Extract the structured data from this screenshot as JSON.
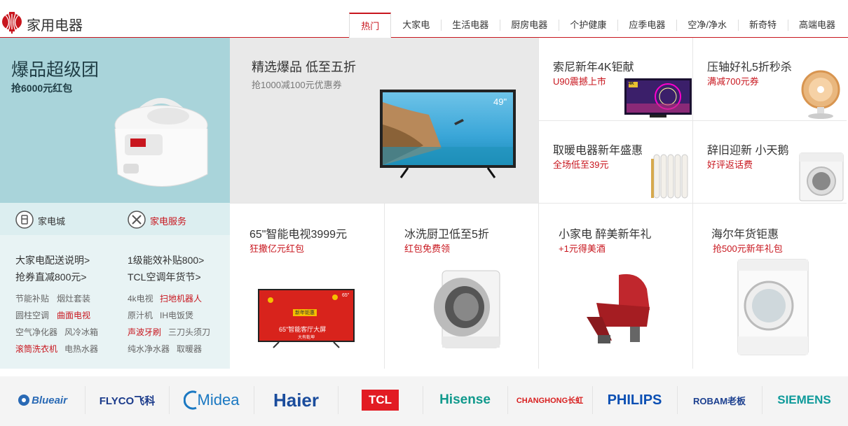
{
  "header": {
    "title": "家用电器",
    "tabs": [
      "热门",
      "大家电",
      "生活电器",
      "厨房电器",
      "个护健康",
      "应季电器",
      "空净/净水",
      "新奇特",
      "高端电器"
    ],
    "active_tab": "热门"
  },
  "hero": {
    "title": "爆品超级团",
    "subtitle": "抢6000元红包"
  },
  "banner": {
    "title": "精选爆品 低至五折",
    "subtitle": "抢1000减100元优惠券",
    "tv_size": "49\"",
    "dots": 4,
    "active_dot": 0
  },
  "promos_top": [
    {
      "title": "索尼新年4K钜献",
      "subtitle": "U90震撼上市",
      "badge": "4K"
    },
    {
      "title": "压轴好礼5折秒杀",
      "subtitle": "满减700元券"
    },
    {
      "title": "取暖电器新年盛惠",
      "subtitle": "全场低至39元"
    },
    {
      "title": "辞旧迎新 小天鹅",
      "subtitle": "好评返话费"
    }
  ],
  "services": {
    "mall": "家电城",
    "service": "家电服务"
  },
  "links": {
    "col1": [
      "大家电配送说明>",
      "抢券直减800元>"
    ],
    "col2": [
      "1级能效补贴800>",
      "TCL空调年货节>"
    ]
  },
  "tags": {
    "col1": [
      [
        "节能补贴",
        "烟灶套装"
      ],
      [
        "圆柱空调",
        "曲面电视"
      ],
      [
        "空气净化器",
        "风冷冰箱"
      ],
      [
        "滚筒洗衣机",
        "电热水器"
      ]
    ],
    "col2": [
      [
        "4k电视",
        "扫地机器人"
      ],
      [
        "原汁机",
        "IH电饭煲"
      ],
      [
        "声波牙刷",
        "三刀头须刀"
      ],
      [
        "纯水净水器",
        "取暖器"
      ]
    ],
    "red": [
      "曲面电视",
      "滚筒洗衣机",
      "扫地机器人",
      "声波牙刷"
    ]
  },
  "promos_bottom": [
    {
      "title": "65\"智能电视3999元",
      "subtitle": "狂撒亿元红包",
      "screen_text": "新年钜惠",
      "screen_sub": "65\"智能客厅大屏",
      "screen_small": "大有乾坤",
      "size": "65\""
    },
    {
      "title": "冰洗厨卫低至5折",
      "subtitle": "红包免费领"
    },
    {
      "title": "小家电 醉美新年礼",
      "subtitle": "+1元得美酒"
    },
    {
      "title": "海尔年货钜惠",
      "subtitle": "抢500元新年礼包"
    }
  ],
  "brands": [
    "Blueair",
    "FLYCO飞科",
    "Midea",
    "Haier",
    "TCL",
    "Hisense",
    "CHANGHONG长虹",
    "PHILIPS",
    "ROBAM老板",
    "SIEMENS"
  ],
  "colors": {
    "accent": "#c8161e",
    "hero_bg": "#a9d4da",
    "link_bg": "#e8f3f4",
    "banner_bg": "#e9e9e9",
    "brand_bar": "#f4f4f4"
  }
}
